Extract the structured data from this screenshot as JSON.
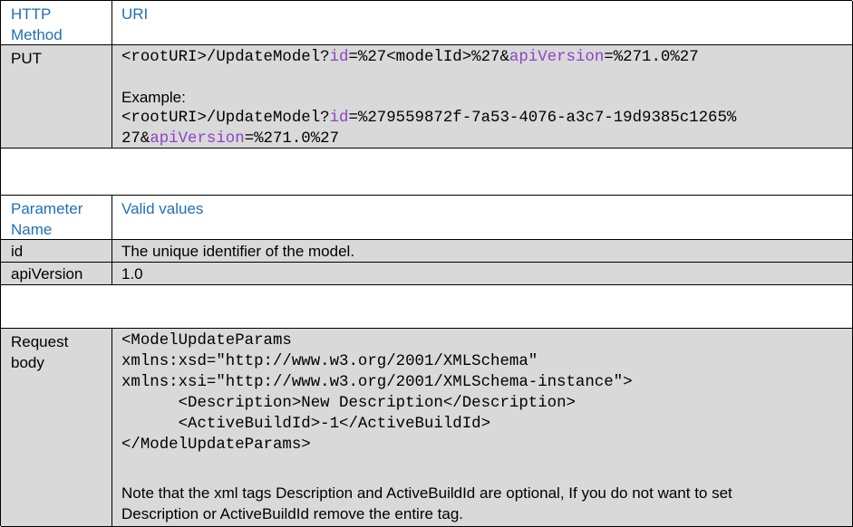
{
  "header1": {
    "col1": "HTTP\nMethod",
    "col2": "URI"
  },
  "method": {
    "verb": "PUT",
    "uri_parts": {
      "a": "<rootURI>/UpdateModel?",
      "p1": "id",
      "b": "=%27<modelId>%27&",
      "p2": "apiVersion",
      "c": "=%271.0%27"
    },
    "example_label": "Example:",
    "example_parts": {
      "a": "<rootURI>/UpdateModel?",
      "p1": "id",
      "b": "=%279559872f-7a53-4076-a3c7-19d9385c1265%",
      "c": "27&",
      "p2": "apiVersion",
      "d": "=%271.0%27"
    }
  },
  "header2": {
    "col1": "Parameter\nName",
    "col2": "Valid values"
  },
  "params": [
    {
      "name": "id",
      "value": "The unique identifier of the model."
    },
    {
      "name": "apiVersion",
      "value": "1.0"
    }
  ],
  "request": {
    "label": "Request\nbody",
    "xml": "<ModelUpdateParams\nxmlns:xsd=\"http://www.w3.org/2001/XMLSchema\"\nxmlns:xsi=\"http://www.w3.org/2001/XMLSchema-instance\">\n\t<Description>New Description</Description>\n\t<ActiveBuildId>-1</ActiveBuildId>\n</ModelUpdateParams>",
    "note": "Note that the xml tags Description and ActiveBuildId are optional, If you do not want to set\nDescription or ActiveBuildId remove the entire tag."
  }
}
